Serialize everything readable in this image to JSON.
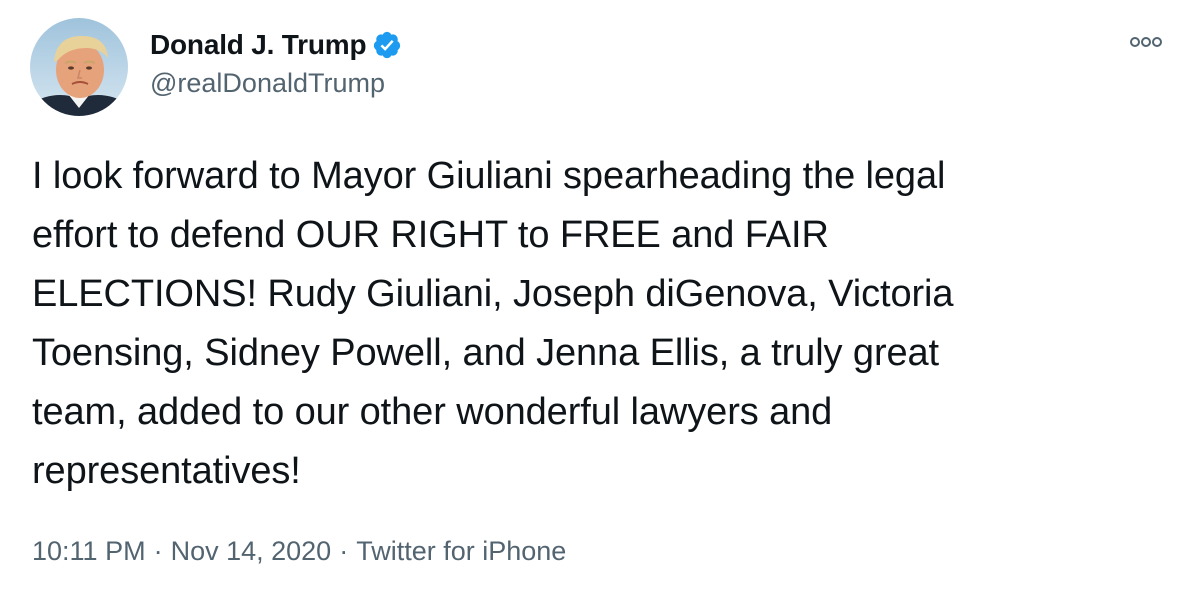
{
  "author": {
    "display_name": "Donald J. Trump",
    "handle": "@realDonaldTrump",
    "verified": true,
    "verified_color": "#1d9bf0"
  },
  "tweet": {
    "text": "I look forward to Mayor Giuliani spearheading the legal\neffort to defend OUR RIGHT to FREE and FAIR\nELECTIONS! Rudy Giuliani, Joseph diGenova, Victoria\nToensing, Sidney Powell, and Jenna Ellis, a truly great\nteam, added to our other wonderful lawyers and\nrepresentatives!",
    "time": "10:11 PM",
    "date": "Nov 14, 2020",
    "source": "Twitter for iPhone",
    "separator": "·"
  },
  "icons": {
    "more": "more-options-icon",
    "verified": "verified-badge-icon"
  },
  "colors": {
    "text_primary": "#0f1419",
    "text_secondary": "#536471",
    "background": "#ffffff"
  }
}
